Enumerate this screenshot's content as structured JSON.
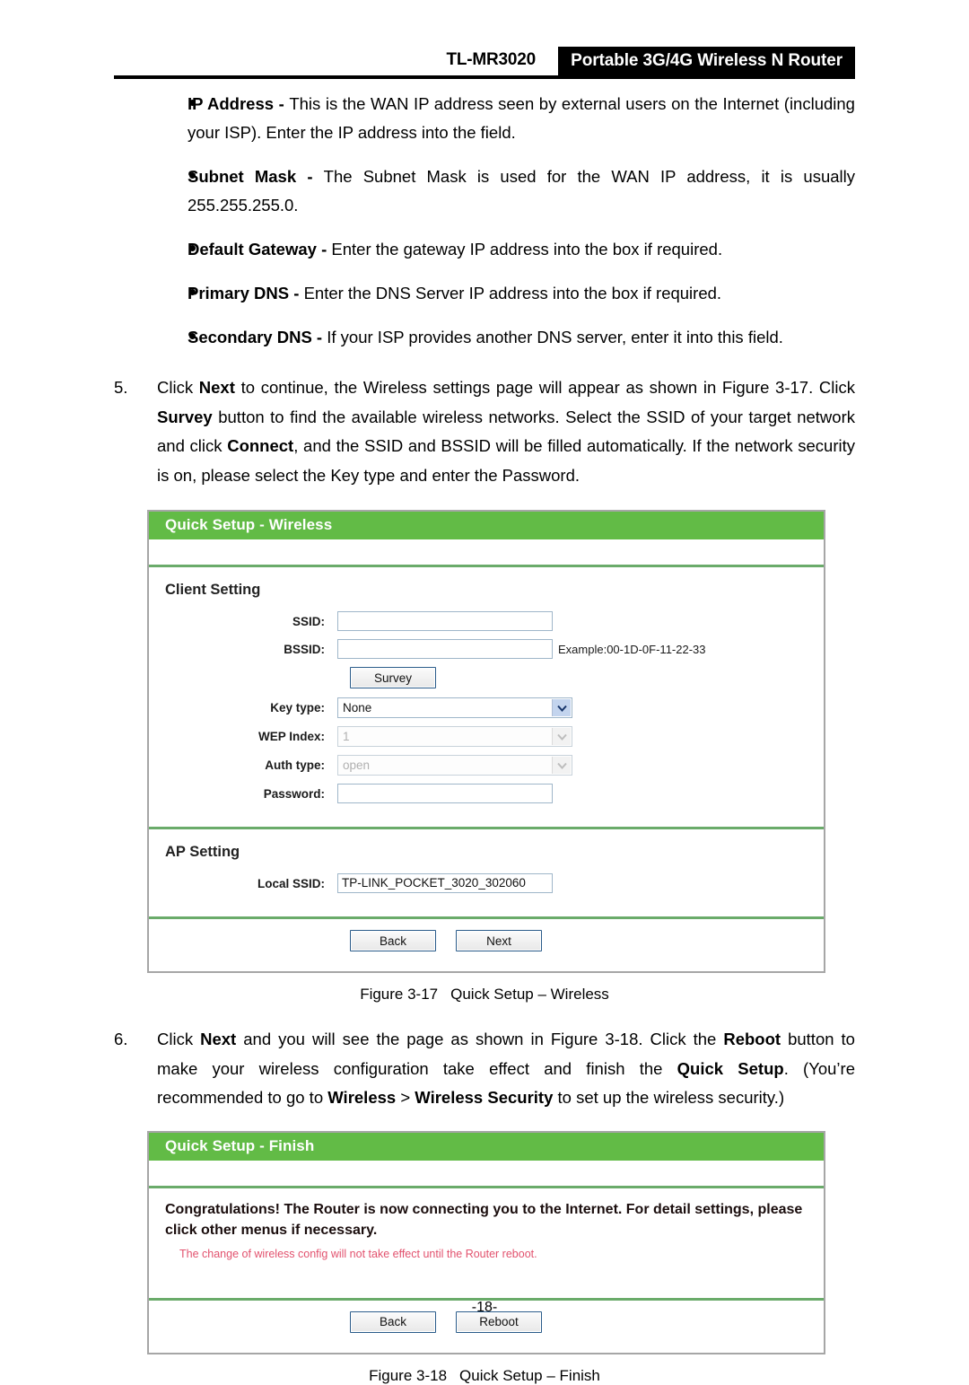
{
  "header": {
    "model": "TL-MR3020",
    "product": "Portable 3G/4G Wireless N Router"
  },
  "bullets": [
    {
      "term": "IP Address",
      "dash": " - ",
      "text": "This is the WAN IP address seen by external users on the Internet (including your ISP). Enter the IP address into the field."
    },
    {
      "term": "Subnet Mask",
      "dash": " - ",
      "text": "The Subnet Mask is used for the WAN IP address, it is usually 255.255.255.0."
    },
    {
      "term": "Default Gateway",
      "dash": " - ",
      "text": "Enter the gateway IP address into the box if required."
    },
    {
      "term": "Primary DNS",
      "dash": " - ",
      "text": "Enter the DNS Server IP address into the box if required."
    },
    {
      "term": "Secondary DNS",
      "dash": " - ",
      "text": "If your ISP provides another DNS server, enter it into this field."
    }
  ],
  "step5": {
    "number": "5.",
    "p1": "Click ",
    "b1": "Next",
    "p2": " to continue, the Wireless settings page will appear as shown in Figure 3-17. Click ",
    "b2": "Survey",
    "p3": " button to find the available wireless networks. Select the SSID of your target network and click ",
    "b3": "Connect",
    "p4": ", and the SSID and BSSID will be filled automatically. If the network security is on, please select the Key type and enter the Password."
  },
  "step6": {
    "number": "6.",
    "p1": "Click ",
    "b1": "Next",
    "p2": " and you will see the page as shown in Figure 3-18. Click the ",
    "b2": "Reboot",
    "p3": " button to make your wireless configuration take effect and finish the ",
    "b3": "Quick Setup",
    "p4": ". (You’re recommended to go to ",
    "b4": "Wireless",
    "p5": " > ",
    "b5": "Wireless Security",
    "p6": " to set up the wireless security.)"
  },
  "wireless_panel": {
    "title": "Quick Setup - Wireless",
    "client_section": "Client Setting",
    "ssid_label": "SSID:",
    "ssid_value": "",
    "bssid_label": "BSSID:",
    "bssid_value": "",
    "bssid_hint": "Example:00-1D-0F-11-22-33",
    "survey_button": "Survey",
    "keytype_label": "Key type:",
    "keytype_value": "None",
    "wepindex_label": "WEP Index:",
    "wepindex_value": "1",
    "authtype_label": "Auth type:",
    "authtype_value": "open",
    "password_label": "Password:",
    "password_value": "",
    "ap_section": "AP Setting",
    "local_ssid_label": "Local SSID:",
    "local_ssid_value": "TP-LINK_POCKET_3020_302060",
    "back_button": "Back",
    "next_button": "Next"
  },
  "figure17": {
    "label": "Figure 3-17",
    "caption": "Quick Setup – Wireless"
  },
  "finish_panel": {
    "title": "Quick Setup - Finish",
    "message": "Congratulations! The Router is now connecting you to the Internet. For detail settings, please click other menus if necessary.",
    "note": "The change of wireless config will not take effect until the Router reboot.",
    "back_button": "Back",
    "reboot_button": "Reboot"
  },
  "figure18": {
    "label": "Figure 3-18",
    "caption": "Quick Setup – Finish"
  },
  "page_number": "-18-",
  "colors": {
    "panel_green": "#62bb46",
    "separator_green": "#6aab6a",
    "note_red": "#e2526e",
    "banner_black": "#000000"
  }
}
